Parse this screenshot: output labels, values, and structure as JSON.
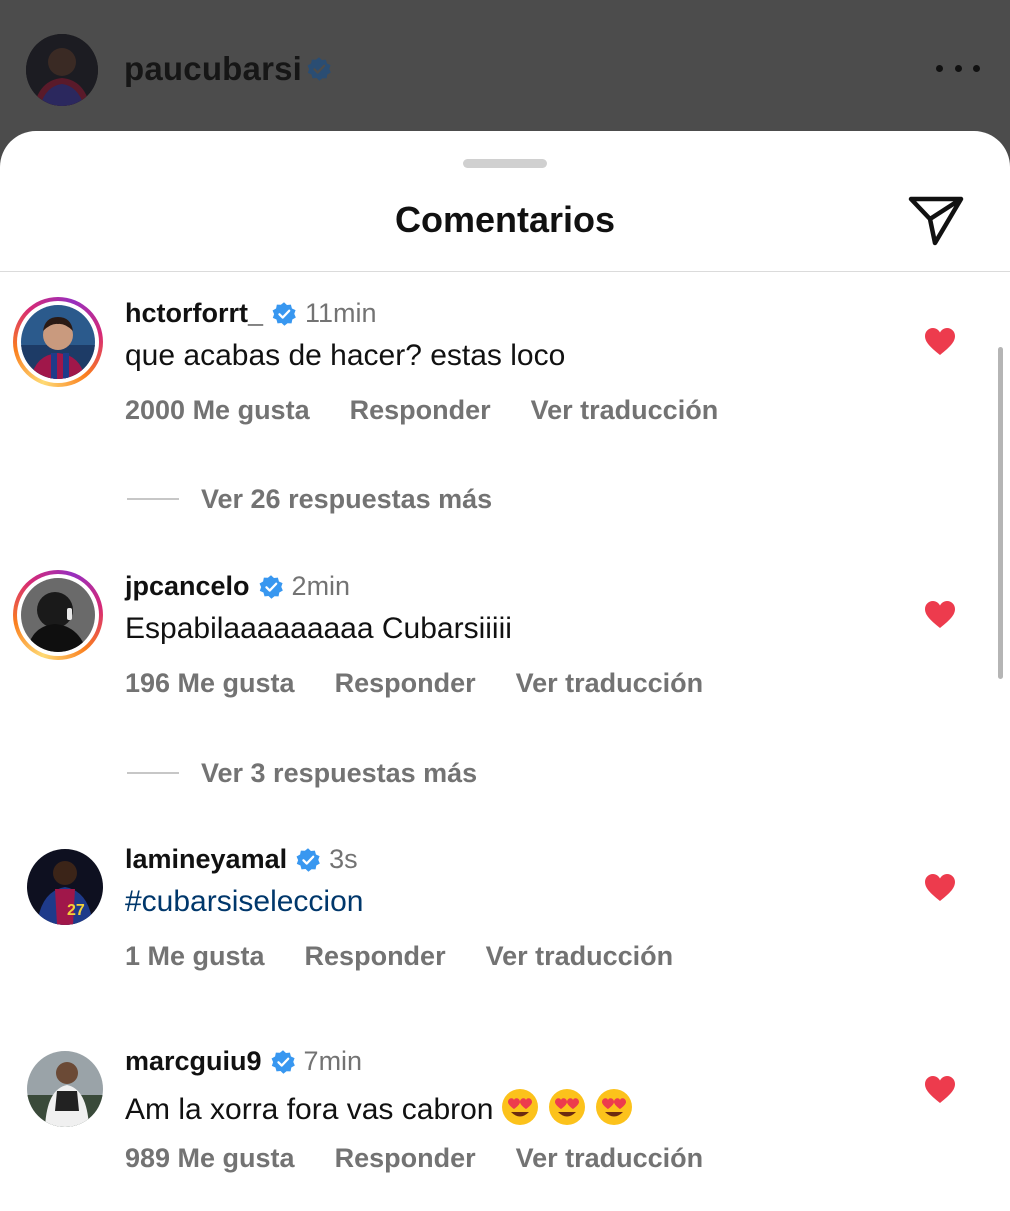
{
  "post_header": {
    "username": "paucubarsi"
  },
  "sheet": {
    "title": "Comentarios"
  },
  "comments": [
    {
      "username": "hctorforrt_",
      "time": "11min",
      "text": "que acabas de hacer? estas loco",
      "likes": "2000 Me gusta",
      "reply": "Responder",
      "translate": "Ver traducción",
      "replies": "Ver 26 respuestas más",
      "liked": true,
      "story_ring": true
    },
    {
      "username": "jpcancelo",
      "time": "2min",
      "text": "Espabilaaaaaaaaa Cubarsiiiii",
      "likes": "196 Me gusta",
      "reply": "Responder",
      "translate": "Ver traducción",
      "replies": "Ver 3 respuestas más",
      "liked": true,
      "story_ring": true
    },
    {
      "username": "lamineyamal",
      "time": "3s",
      "text": "#cubarsiseleccion",
      "likes": "1 Me gusta",
      "reply": "Responder",
      "translate": "Ver traducción",
      "liked": true,
      "story_ring": false
    },
    {
      "username": "marcguiu9",
      "time": "7min",
      "text": "Am la xorra fora vas cabron",
      "emojis": [
        "heart-eyes-emoji",
        "heart-eyes-emoji",
        "heart-eyes-emoji"
      ],
      "likes": "989 Me gusta",
      "reply": "Responder",
      "translate": "Ver traducción",
      "liked": true,
      "story_ring": false
    }
  ],
  "colors": {
    "verified": "#3897f0",
    "heart": "#ed3b4d",
    "secondary_text": "#737373",
    "hashtag": "#00376b"
  },
  "icons": [
    "verified-badge-icon",
    "more-options-icon",
    "share-send-icon",
    "heart-icon",
    "heart-eyes-emoji"
  ]
}
